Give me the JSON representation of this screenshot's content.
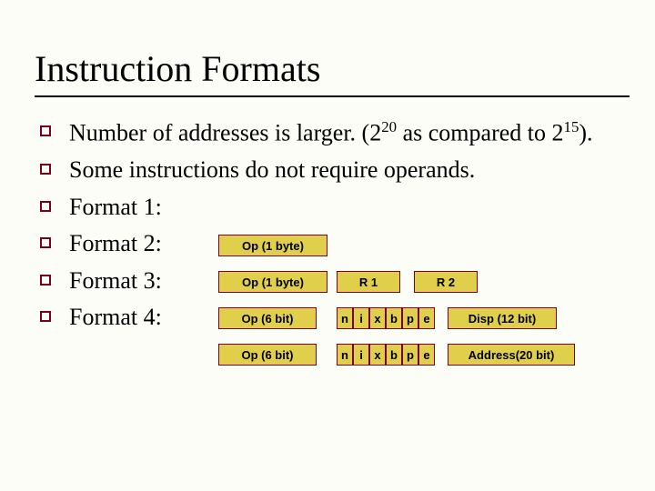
{
  "title": "Instruction Formats",
  "bullets": {
    "b1_pre": "Number of addresses is larger. (2",
    "b1_sup1": "20",
    "b1_mid": " as compared to 2",
    "b1_sup2": "15",
    "b1_post": ").",
    "b2": "Some instructions do not require operands.",
    "b3": "Format 1:",
    "b4": "Format 2:",
    "b5": "Format 3:",
    "b6": "Format 4:"
  },
  "formats": {
    "f1": {
      "op": "Op (1 byte)"
    },
    "f2": {
      "op": "Op (1 byte)",
      "r1": "R 1",
      "r2": "R 2"
    },
    "f3": {
      "op": "Op (6 bit)",
      "flags": [
        "n",
        "i",
        "x",
        "b",
        "p",
        "e"
      ],
      "disp": "Disp (12 bit)"
    },
    "f4": {
      "op": "Op (6 bit)",
      "flags": [
        "n",
        "i",
        "x",
        "b",
        "p",
        "e"
      ],
      "addr": "Address(20 bit)"
    }
  }
}
